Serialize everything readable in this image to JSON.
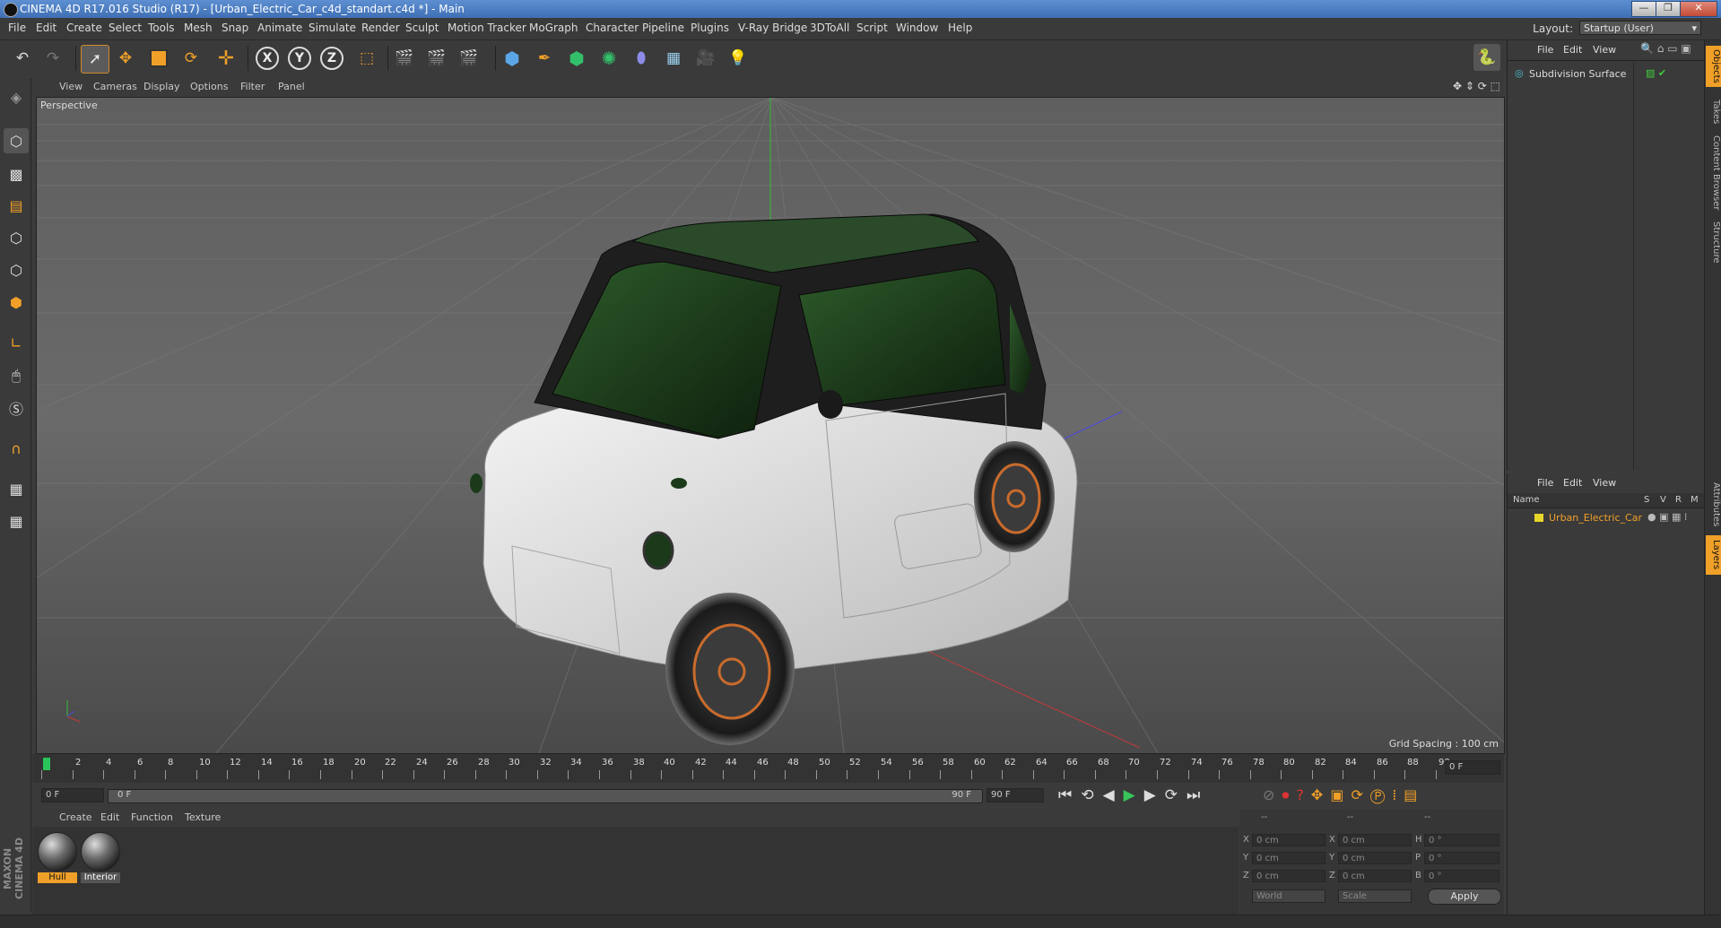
{
  "window": {
    "title": "CINEMA 4D R17.016 Studio (R17) - [Urban_Electric_Car_c4d_standart.c4d *] - Main"
  },
  "menubar": {
    "items": [
      "File",
      "Edit",
      "Create",
      "Select",
      "Tools",
      "Mesh",
      "Snap",
      "Animate",
      "Simulate",
      "Render",
      "Sculpt",
      "Motion Tracker",
      "MoGraph",
      "Character",
      "Pipeline",
      "Plugins",
      "V-Ray Bridge",
      "3DToAll",
      "Script",
      "Window",
      "Help"
    ],
    "layout_label": "Layout:",
    "layout_value": "Startup (User)"
  },
  "viewport": {
    "menu": [
      "View",
      "Cameras",
      "Display",
      "Options",
      "Filter",
      "Panel"
    ],
    "label": "Perspective",
    "grid_spacing": "Grid Spacing : 100 cm"
  },
  "timeline": {
    "ticks": [
      "0",
      "2",
      "4",
      "6",
      "8",
      "10",
      "12",
      "14",
      "16",
      "18",
      "20",
      "22",
      "24",
      "26",
      "28",
      "30",
      "32",
      "34",
      "36",
      "38",
      "40",
      "42",
      "44",
      "46",
      "48",
      "50",
      "52",
      "54",
      "56",
      "58",
      "60",
      "62",
      "64",
      "66",
      "68",
      "70",
      "72",
      "74",
      "76",
      "78",
      "80",
      "82",
      "84",
      "86",
      "88",
      "90"
    ],
    "current_frame": "0 F",
    "start_field": "0 F",
    "range_start": "0 F",
    "range_end": "90 F",
    "end_field": "90 F"
  },
  "materials": {
    "menu": [
      "Create",
      "Edit",
      "Function",
      "Texture"
    ],
    "items": [
      "Hull",
      "Interior"
    ]
  },
  "coordinates": {
    "header": [
      "--",
      "--",
      "--"
    ],
    "rows": [
      {
        "axis": "X",
        "pos": "0 cm",
        "axis2": "X",
        "size": "0 cm",
        "rot_label": "H",
        "rot": "0 °"
      },
      {
        "axis": "Y",
        "pos": "0 cm",
        "axis2": "Y",
        "size": "0 cm",
        "rot_label": "P",
        "rot": "0 °"
      },
      {
        "axis": "Z",
        "pos": "0 cm",
        "axis2": "Z",
        "size": "0 cm",
        "rot_label": "B",
        "rot": "0 °"
      }
    ],
    "mode1": "World",
    "mode2": "Scale",
    "apply": "Apply"
  },
  "objects_panel": {
    "menu": [
      "File",
      "Edit",
      "View"
    ],
    "items": [
      {
        "name": "Subdivision Surface"
      }
    ]
  },
  "layers_panel": {
    "menu": [
      "File",
      "Edit",
      "View"
    ],
    "columns": [
      "Name",
      "S",
      "V",
      "R",
      "M"
    ],
    "items": [
      {
        "name": "Urban_Electric_Car",
        "color": "#e6d62a"
      }
    ]
  },
  "right_tabs": [
    "Objects",
    "Takes",
    "Content Browser",
    "Structure",
    "Attributes",
    "Layers"
  ],
  "brand": {
    "text": "MAXON CINEMA 4D"
  }
}
